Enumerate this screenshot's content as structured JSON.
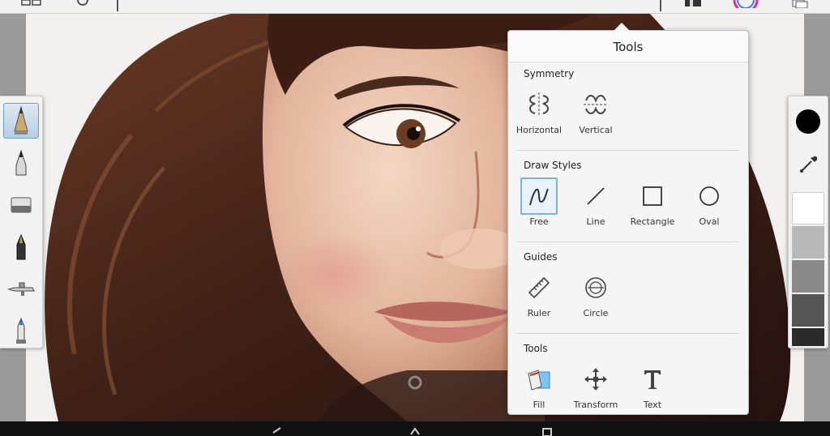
{
  "toolbar": {
    "icons": [
      "layout-icon",
      "settings-icon",
      "layers-icon",
      "color-wheel-icon",
      "copy-icon"
    ]
  },
  "popup": {
    "title": "Tools",
    "symmetry": {
      "heading": "Symmetry",
      "options": [
        {
          "label": "Horizontal",
          "icon": "symmetry-horizontal-icon"
        },
        {
          "label": "Vertical",
          "icon": "symmetry-vertical-icon"
        }
      ]
    },
    "draw_styles": {
      "heading": "Draw Styles",
      "selected": "Free",
      "options": [
        {
          "label": "Free",
          "icon": "free-draw-icon"
        },
        {
          "label": "Line",
          "icon": "line-icon"
        },
        {
          "label": "Rectangle",
          "icon": "rectangle-icon"
        },
        {
          "label": "Oval",
          "icon": "oval-icon"
        }
      ]
    },
    "guides": {
      "heading": "Guides",
      "options": [
        {
          "label": "Ruler",
          "icon": "ruler-icon"
        },
        {
          "label": "Circle",
          "icon": "circle-guide-icon"
        }
      ]
    },
    "tools": {
      "heading": "Tools",
      "options": [
        {
          "label": "Fill",
          "icon": "fill-bucket-icon"
        },
        {
          "label": "Transform",
          "icon": "transform-icon"
        },
        {
          "label": "Text",
          "icon": "text-icon"
        }
      ]
    }
  },
  "brushes": [
    {
      "name": "pencil",
      "selected": true,
      "icon": "pencil-icon"
    },
    {
      "name": "ballpoint",
      "icon": "ballpoint-pen-icon"
    },
    {
      "name": "eraser",
      "icon": "eraser-icon"
    },
    {
      "name": "ink-pen",
      "icon": "ink-pen-icon"
    },
    {
      "name": "airbrush",
      "icon": "airbrush-icon"
    },
    {
      "name": "marker",
      "icon": "marker-icon"
    }
  ],
  "colors": {
    "current_color": "#000000",
    "swatches": [
      "#ffffff",
      "#b8b8b8",
      "#8a8a8a",
      "#555555",
      "#2a2a2a",
      "#000000"
    ],
    "accent": "#7fb1d9"
  }
}
